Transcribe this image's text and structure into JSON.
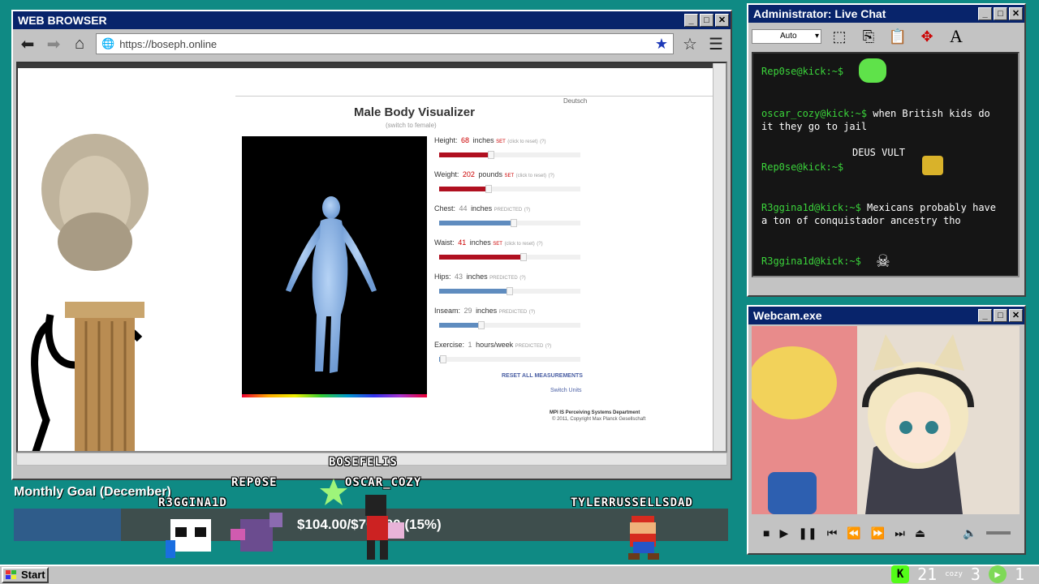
{
  "browser": {
    "title": "WEB BROWSER",
    "url": "https://boseph.online",
    "page": {
      "deutsch": "Deutsch",
      "title": "Male Body Visualizer",
      "subtitle": "(switch to female)",
      "sliders": [
        {
          "label": "Height:",
          "value": "68",
          "unit": "inches",
          "status": "SET",
          "link": "(click to reset)",
          "help": "(?)",
          "fraction": 0.37,
          "predicted": false
        },
        {
          "label": "Weight:",
          "value": "202",
          "unit": "pounds",
          "status": "SET",
          "link": "(click to reset)",
          "help": "(?)",
          "fraction": 0.35,
          "predicted": false
        },
        {
          "label": "Chest:",
          "value": "44",
          "unit": "inches",
          "status": "PREDICTED",
          "link": "",
          "help": "(?)",
          "fraction": 0.53,
          "predicted": true
        },
        {
          "label": "Waist:",
          "value": "41",
          "unit": "inches",
          "status": "SET",
          "link": "(click to reset)",
          "help": "(?)",
          "fraction": 0.6,
          "predicted": false
        },
        {
          "label": "Hips:",
          "value": "43",
          "unit": "inches",
          "status": "PREDICTED",
          "link": "",
          "help": "(?)",
          "fraction": 0.5,
          "predicted": true
        },
        {
          "label": "Inseam:",
          "value": "29",
          "unit": "inches",
          "status": "PREDICTED",
          "link": "",
          "help": "(?)",
          "fraction": 0.3,
          "predicted": true
        },
        {
          "label": "Exercise:",
          "value": "1",
          "unit": "hours/week",
          "status": "PREDICTED",
          "link": "",
          "help": "(?)",
          "fraction": 0.03,
          "predicted": true
        }
      ],
      "reset_all": "RESET ALL MEASUREMENTS",
      "switch_units": "Switch Units",
      "footer_org": "MPI IS Perceiving Systems Department",
      "footer_copy": "© 2011, Copyright Max Planck Gesellschaft"
    }
  },
  "chat": {
    "title": "Administrator: Live Chat",
    "dropdown": "Auto",
    "messages": [
      {
        "user": "Rep0se@kick:~$",
        "text": ""
      },
      {
        "user": "oscar_cozy@kick:~$",
        "text": " when British kids do it they go to jail"
      },
      {
        "user": "",
        "text": "DEUS VULT"
      },
      {
        "user": "Rep0se@kick:~$",
        "text": ""
      },
      {
        "user": "R3ggina1d@kick:~$",
        "text": " Mexicans probably have a ton of conquistador ancestry tho"
      },
      {
        "user": "R3ggina1d@kick:~$",
        "text": ""
      }
    ]
  },
  "webcam": {
    "title": "Webcam.exe"
  },
  "overlay": {
    "goal_label": "Monthly Goal (December)",
    "goal_text": "$104.00/$700.00 (15%)",
    "goal_fraction": 0.15,
    "names": [
      "BOSEFELIS",
      "REP0SE",
      "OSCAR_COZY",
      "R3GGINA1D",
      "TYLERRUSSELLSDAD"
    ]
  },
  "taskbar": {
    "start": "Start",
    "count_a": "21",
    "count_b": "3",
    "count_c": "1"
  },
  "colors": {
    "desktop": "#0f8a84",
    "titlebar": "#08246b",
    "chat_user": "#3bd43b",
    "kick_green": "#53fc18"
  }
}
